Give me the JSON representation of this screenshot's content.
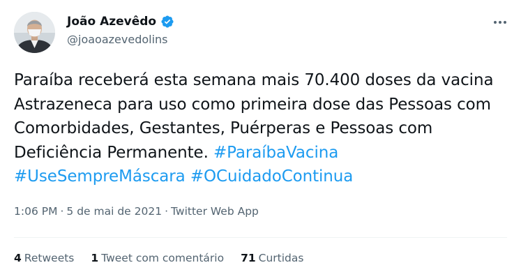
{
  "author": {
    "name": "João Azevêdo",
    "handle": "@joaoazevedolins",
    "verified_color": "#1d9bf0"
  },
  "tweet": {
    "text_plain": "Paraíba receberá esta semana mais 70.400 doses da vacina Astrazeneca para uso como primeira dose das Pessoas com Comorbidades, Gestantes, Puérperas e Pessoas com Deficiência Permanente.",
    "hashtags": [
      "#ParaíbaVacina",
      "#UseSempreMáscara",
      "#OCuidadoContinua"
    ],
    "hashtag_color": "#1d9bf0"
  },
  "meta": {
    "time": "1:06 PM",
    "separator": "·",
    "date": "5 de mai de 2021",
    "source": "Twitter Web App"
  },
  "stats": {
    "retweets_count": "4",
    "retweets_label": "Retweets",
    "quotes_count": "1",
    "quotes_label": "Tweet com comentário",
    "likes_count": "71",
    "likes_label": "Curtidas"
  },
  "icons": {
    "verified": "verified-badge-icon",
    "more": "more-horizontal-icon"
  }
}
